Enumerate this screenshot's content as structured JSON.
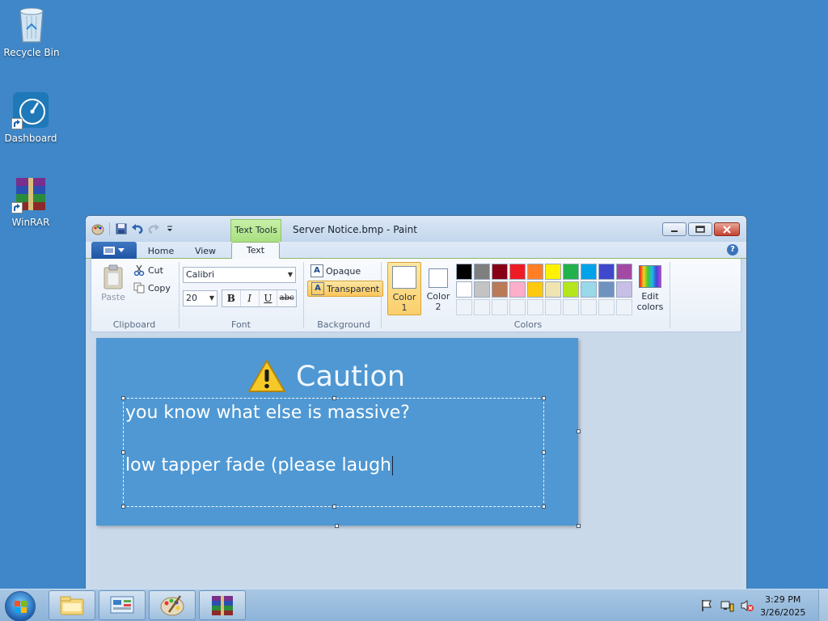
{
  "desktop": {
    "icons": [
      {
        "label": "Recycle Bin",
        "icon": "recycle-bin-icon"
      },
      {
        "label": "Dashboard",
        "icon": "dashboard-icon"
      },
      {
        "label": "WinRAR",
        "icon": "winrar-icon"
      }
    ]
  },
  "window": {
    "title": "Server Notice.bmp - Paint",
    "contextual_tab": "Text Tools"
  },
  "tabs": [
    "Home",
    "View",
    "Text"
  ],
  "active_tab": "Text",
  "ribbon": {
    "clipboard": {
      "title": "Clipboard",
      "paste": "Paste",
      "cut": "Cut",
      "copy": "Copy"
    },
    "font": {
      "title": "Font",
      "family": "Calibri",
      "size": "20",
      "bold": "B",
      "italic": "I",
      "underline": "U",
      "strikethrough": "abc"
    },
    "background": {
      "title": "Background",
      "opaque": "Opaque",
      "transparent": "Transparent",
      "selected": "Transparent"
    },
    "colors": {
      "title": "Colors",
      "color1_a": "Color",
      "color1_b": "1",
      "color2_a": "Color",
      "color2_b": "2",
      "edit_a": "Edit",
      "edit_b": "colors",
      "color1_value": "#ffffff",
      "color2_value": "#ffffff",
      "row1": [
        "#000000",
        "#7f7f7f",
        "#880015",
        "#ed1c24",
        "#ff7f27",
        "#fff200",
        "#22b14c",
        "#00a2e8",
        "#3f48cc",
        "#a349a4"
      ],
      "row2": [
        "#ffffff",
        "#c3c3c3",
        "#b97a57",
        "#ffaec9",
        "#ffc90e",
        "#efe4b0",
        "#b5e61d",
        "#99d9ea",
        "#7092be",
        "#c8bfe7"
      ]
    }
  },
  "canvas": {
    "background": "#4f98d3",
    "heading": "Caution",
    "text_line1": "you know what else is massive?",
    "text_line2": "low tapper fade (please laugh"
  },
  "taskbar": {
    "time": "3:29 PM",
    "date": "3/26/2025",
    "apps": [
      "file-explorer-icon",
      "control-panel-icon",
      "paint-icon",
      "winrar-icon"
    ]
  }
}
